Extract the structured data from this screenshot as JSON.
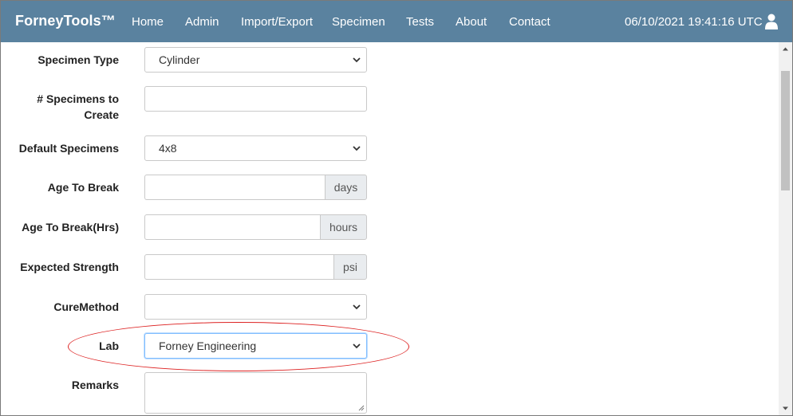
{
  "navbar": {
    "brand": "ForneyTools™",
    "links": [
      "Home",
      "Admin",
      "Import/Export",
      "Specimen",
      "Tests",
      "About",
      "Contact"
    ],
    "datetime": "06/10/2021 19:41:16 UTC",
    "user_icon": "user-icon",
    "bg_color": "#5a829f"
  },
  "form": {
    "specimen_type": {
      "label": "Specimen Type",
      "value": "Cylinder"
    },
    "specimens_to_create": {
      "label_line1": "# Specimens to",
      "label_line2": "Create",
      "value": ""
    },
    "default_specimens": {
      "label": "Default Specimens",
      "value": "4x8"
    },
    "age_to_break": {
      "label": "Age To Break",
      "value": "",
      "unit": "days"
    },
    "age_to_break_hrs": {
      "label": "Age To Break(Hrs)",
      "value": "",
      "unit": "hours"
    },
    "expected_strength": {
      "label": "Expected Strength",
      "value": "",
      "unit": "psi"
    },
    "cure_method": {
      "label": "CureMethod",
      "value": ""
    },
    "lab": {
      "label": "Lab",
      "value": "Forney Engineering"
    },
    "remarks": {
      "label": "Remarks",
      "value": ""
    }
  },
  "annotation": {
    "color": "#dd2222"
  }
}
